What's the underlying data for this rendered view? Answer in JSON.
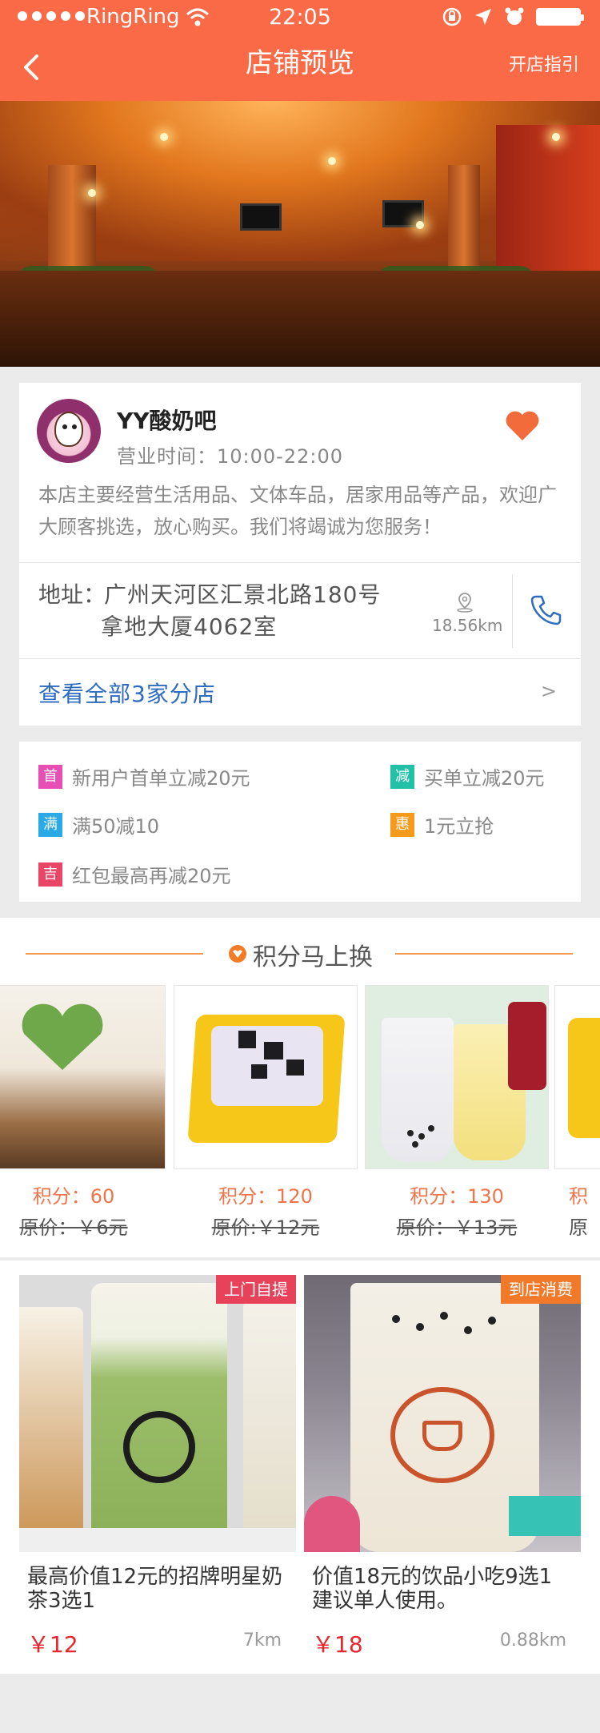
{
  "status_bar": {
    "carrier": "RingRing",
    "time": "22:05"
  },
  "nav": {
    "title": "店铺预览",
    "right_link": "开店指引"
  },
  "shop": {
    "name": "YY酸奶吧",
    "hours": "营业时间：10:00-22:00",
    "description": "本店主要经营生活用品、文体车品，居家用品等产品，欢迎广大顾客挑选，放心购买。我们将竭诚为您服务！",
    "address_label": "地址：",
    "address_line1": "广州天河区汇景北路180号",
    "address_line2": "拿地大厦4062室",
    "distance": "18.56km",
    "branches_link": "查看全部3家分店",
    "branches_arrow": ">"
  },
  "promotions": [
    {
      "tag": "首",
      "tag_color": "#e84fb5",
      "text": "新用户首单立减20元"
    },
    {
      "tag": "减",
      "tag_color": "#22c0a6",
      "text": "买单立减20元"
    },
    {
      "tag": "满",
      "tag_color": "#29a9e6",
      "text": "满50减10"
    },
    {
      "tag": "惠",
      "tag_color": "#f59a1b",
      "text": "1元立抢"
    },
    {
      "tag": "吉",
      "tag_color": "#ea4566",
      "text": "红包最高再减20元"
    }
  ],
  "points_section": {
    "title": "积分马上换",
    "items": [
      {
        "score": "积分：60",
        "original": "原价：￥6元"
      },
      {
        "score": "积分：120",
        "original": "原价:￥12元"
      },
      {
        "score": "积分：130",
        "original": "原价：￥13元"
      },
      {
        "score": "积",
        "original": "原"
      }
    ]
  },
  "deals": [
    {
      "badge": "上门自提",
      "badge_color": "#e8425b",
      "title": "最高价值12元的招牌明星奶茶3选1",
      "price": "￥12",
      "distance": "7km"
    },
    {
      "badge": "到店消费",
      "badge_color": "#f07a2a",
      "title": "价值18元的饮品小吃9选1建议单人使用。",
      "price": "￥18",
      "distance": "0.88km"
    }
  ],
  "colors": {
    "header": "#fb6a47",
    "link_blue": "#2d6cc0",
    "price_red": "#e9262d",
    "points_orange": "#f0744a"
  }
}
